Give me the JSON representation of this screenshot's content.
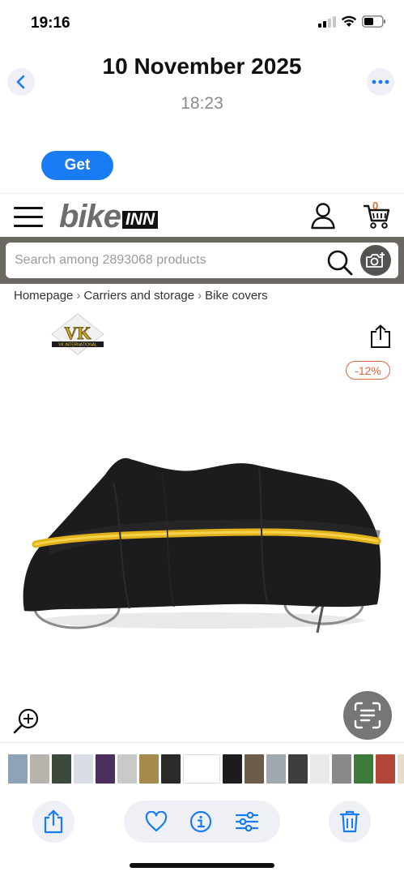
{
  "status_bar": {
    "time": "19:16",
    "icons": [
      "signal-icon",
      "wifi-icon",
      "battery-icon"
    ]
  },
  "photos_header": {
    "date": "10 November 2025",
    "time": "18:23",
    "back_icon": "chevron-left-icon",
    "more_icon": "ellipsis-icon"
  },
  "banner": {
    "get_label": "Get"
  },
  "site": {
    "logo_bike": "bike",
    "logo_inn": "INN",
    "cart_count": "0",
    "search_placeholder": "Search among 2893068 products",
    "breadcrumb": [
      "Homepage",
      "Carriers and storage",
      "Bike covers"
    ],
    "brand_logo_text": "VK",
    "brand_logo_subtext": "VK INTERNATIONAL",
    "discount": "-12%"
  },
  "colors": {
    "accent": "#1a7cf5",
    "discount": "#e0673d",
    "search_bar_bg": "#6b6863"
  },
  "toolbar": {
    "icons": [
      "share-icon",
      "heart-icon",
      "info-icon",
      "adjust-icon",
      "trash-icon"
    ]
  }
}
